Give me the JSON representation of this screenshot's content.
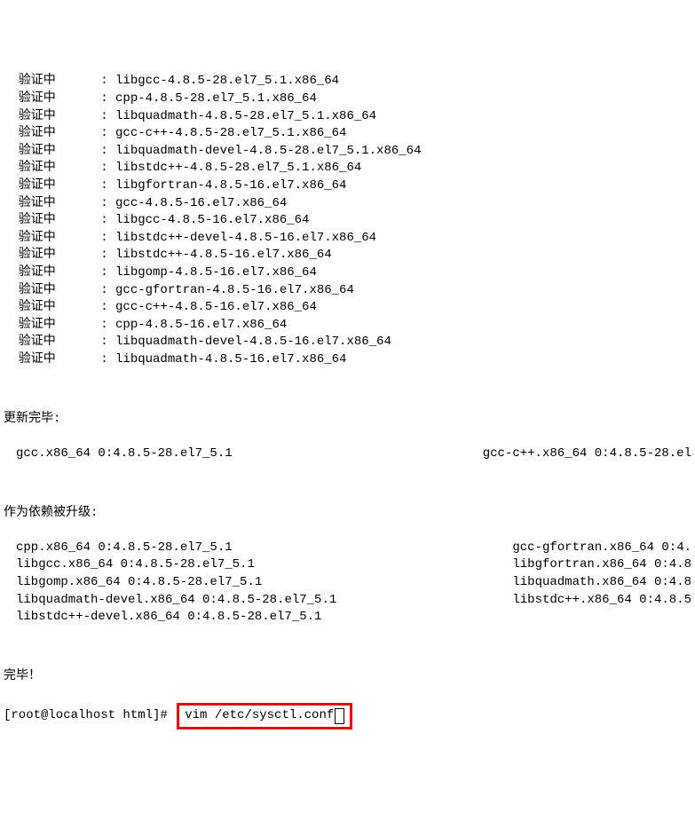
{
  "verif": {
    "label": "验证中",
    "sep": ":",
    "pkgs": [
      "libgcc-4.8.5-28.el7_5.1.x86_64",
      "cpp-4.8.5-28.el7_5.1.x86_64",
      "libquadmath-4.8.5-28.el7_5.1.x86_64",
      "gcc-c++-4.8.5-28.el7_5.1.x86_64",
      "libquadmath-devel-4.8.5-28.el7_5.1.x86_64",
      "libstdc++-4.8.5-28.el7_5.1.x86_64",
      "libgfortran-4.8.5-16.el7.x86_64",
      "gcc-4.8.5-16.el7.x86_64",
      "libgcc-4.8.5-16.el7.x86_64",
      "libstdc++-devel-4.8.5-16.el7.x86_64",
      "libstdc++-4.8.5-16.el7.x86_64",
      "libgomp-4.8.5-16.el7.x86_64",
      "gcc-gfortran-4.8.5-16.el7.x86_64",
      "gcc-c++-4.8.5-16.el7.x86_64",
      "cpp-4.8.5-16.el7.x86_64",
      "libquadmath-devel-4.8.5-16.el7.x86_64",
      "libquadmath-4.8.5-16.el7.x86_64"
    ]
  },
  "updated": {
    "header": "更新完毕:",
    "left": "gcc.x86_64 0:4.8.5-28.el7_5.1",
    "right": "gcc-c++.x86_64 0:4.8.5-28.el"
  },
  "deps": {
    "header": "作为依赖被升级:",
    "rows": [
      {
        "left": "cpp.x86_64 0:4.8.5-28.el7_5.1",
        "right": "gcc-gfortran.x86_64 0:4."
      },
      {
        "left": "libgcc.x86_64 0:4.8.5-28.el7_5.1",
        "right": "libgfortran.x86_64 0:4.8"
      },
      {
        "left": "libgomp.x86_64 0:4.8.5-28.el7_5.1",
        "right": "libquadmath.x86_64 0:4.8"
      },
      {
        "left": "libquadmath-devel.x86_64 0:4.8.5-28.el7_5.1",
        "right": "libstdc++.x86_64 0:4.8.5"
      },
      {
        "left": "libstdc++-devel.x86_64 0:4.8.5-28.el7_5.1",
        "right": ""
      }
    ]
  },
  "done": "完毕！",
  "prompt": {
    "prefix": "[root@localhost html]# ",
    "command": "vim /etc/sysctl.conf"
  }
}
